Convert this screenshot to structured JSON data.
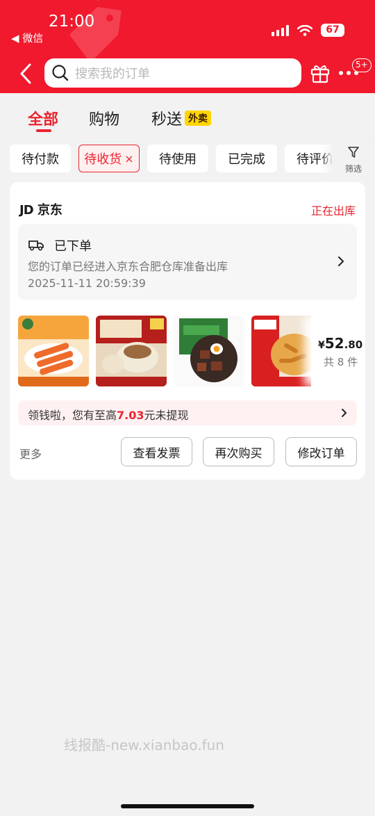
{
  "status_bar": {
    "time": "21:00",
    "back_app": "◀ 微信",
    "battery": "67"
  },
  "search": {
    "placeholder": "搜索我的订单"
  },
  "header": {
    "more_badge": "5+"
  },
  "tabs": [
    {
      "label": "全部",
      "active": true
    },
    {
      "label": "购物",
      "active": false
    },
    {
      "label": "秒送",
      "active": false,
      "badge": "外卖"
    }
  ],
  "filters": {
    "chips": [
      {
        "label": "待付款",
        "selected": false
      },
      {
        "label": "待收货",
        "selected": true,
        "close": "×"
      },
      {
        "label": "待使用",
        "selected": false
      },
      {
        "label": "已完成",
        "selected": false
      },
      {
        "label": "待评价",
        "selected": false
      }
    ],
    "filter_label": "筛选"
  },
  "order": {
    "shop_logo": "JD",
    "shop_name": "京东",
    "status": "正在出库",
    "logistics": {
      "title": "已下单",
      "desc": "您的订单已经进入京东合肥仓库准备出库",
      "time": "2025-11-11 20:59:39"
    },
    "products": [
      {
        "name": "product-crab-sticks",
        "colors": [
          "#f6a53c",
          "#fbe6c6"
        ]
      },
      {
        "name": "product-siu-mai",
        "colors": [
          "#b51f1c",
          "#e9d7bf"
        ]
      },
      {
        "name": "product-braised-beef",
        "colors": [
          "#2f7d37",
          "#7b3a25"
        ]
      },
      {
        "name": "product-fried-pork",
        "colors": [
          "#d82020",
          "#e7a84a"
        ]
      },
      {
        "name": "product-extra",
        "colors": [
          "#eeeeee",
          "#dddddd"
        ]
      }
    ],
    "price": {
      "currency": "¥",
      "integer": "52",
      "decimal": ".80"
    },
    "count_text": "共 8 件",
    "promo": {
      "prefix": "领钱啦，您有至高",
      "amount": "7.03",
      "suffix": "元未提现"
    },
    "more_label": "更多",
    "actions": [
      "查看发票",
      "再次购买",
      "修改订单"
    ]
  },
  "watermark": "线报酷-new.xianbao.fun",
  "colors": {
    "brand_red": "#f0192d",
    "accent_red": "#e9242f",
    "badge_yellow": "#ffd600"
  }
}
